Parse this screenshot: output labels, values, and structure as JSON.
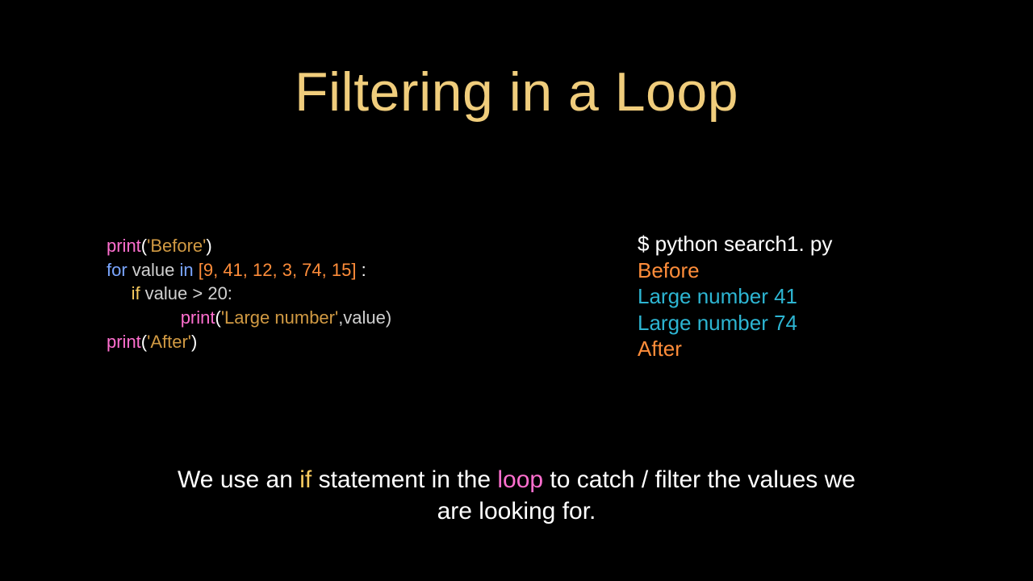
{
  "title": "Filtering in a Loop",
  "code": {
    "print1_fn": "print",
    "print1_open": "(",
    "print1_str": "'Before'",
    "print1_close": ")",
    "for_kw": "for",
    "for_var": " value ",
    "in_kw": "in",
    "list": " [9, 41, 12, 3, 74, 15]",
    "for_tail": " :",
    "if_indent": "     ",
    "if_kw": "if",
    "if_cond": " value > 20:",
    "print2_indent": "               ",
    "print2_fn": "print",
    "print2_open": "(",
    "print2_str": "'Large number'",
    "print2_rest": ",value)",
    "print3_fn": "print",
    "print3_open": "(",
    "print3_str": "'After'",
    "print3_close": ")"
  },
  "output": {
    "cmd": "$ python search1. py",
    "before": "Before",
    "l1": "Large number 41",
    "l2": "Large number 74",
    "after": "After"
  },
  "caption": {
    "p1": "We use an ",
    "if": "if",
    "p2": " statement in the ",
    "loop": "loop",
    "p3": " to catch / filter the values we are looking for."
  }
}
